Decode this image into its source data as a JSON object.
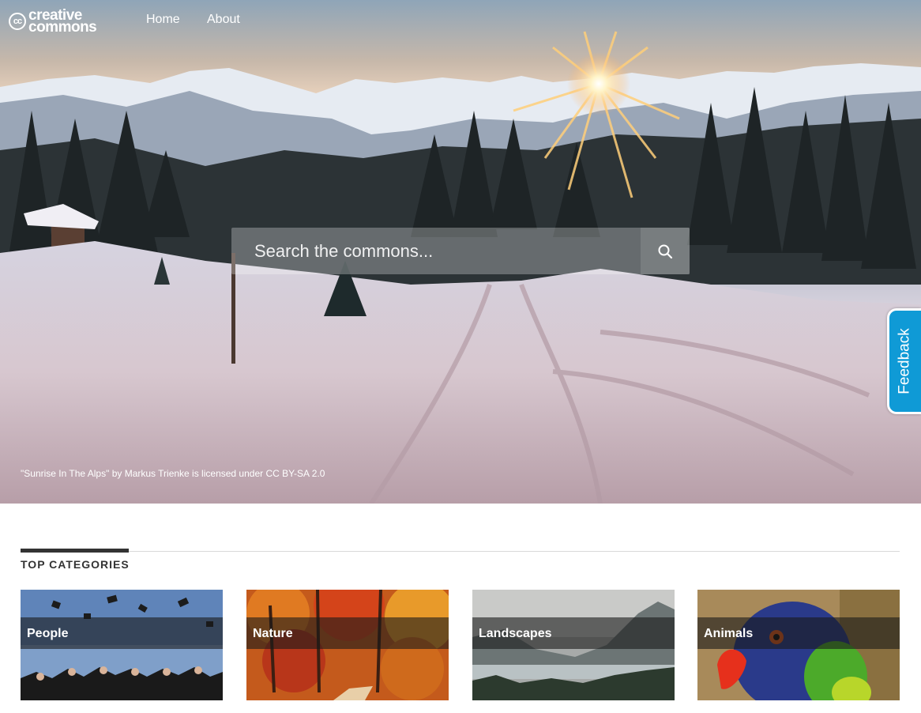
{
  "brand": {
    "logo_mark": "cc",
    "logo_line1": "creative",
    "logo_line2": "commons"
  },
  "nav": {
    "home_label": "Home",
    "about_label": "About"
  },
  "search": {
    "placeholder": "Search the commons...",
    "icon": "search-icon"
  },
  "hero": {
    "attribution": "\"Sunrise In The Alps\" by Markus Trienke is licensed under CC BY-SA 2.0"
  },
  "feedback": {
    "label": "Feedback",
    "color": "#0f9ad6"
  },
  "categories": {
    "title": "TOP CATEGORIES",
    "items": [
      {
        "label": "People"
      },
      {
        "label": "Nature"
      },
      {
        "label": "Landscapes"
      },
      {
        "label": "Animals"
      }
    ]
  }
}
